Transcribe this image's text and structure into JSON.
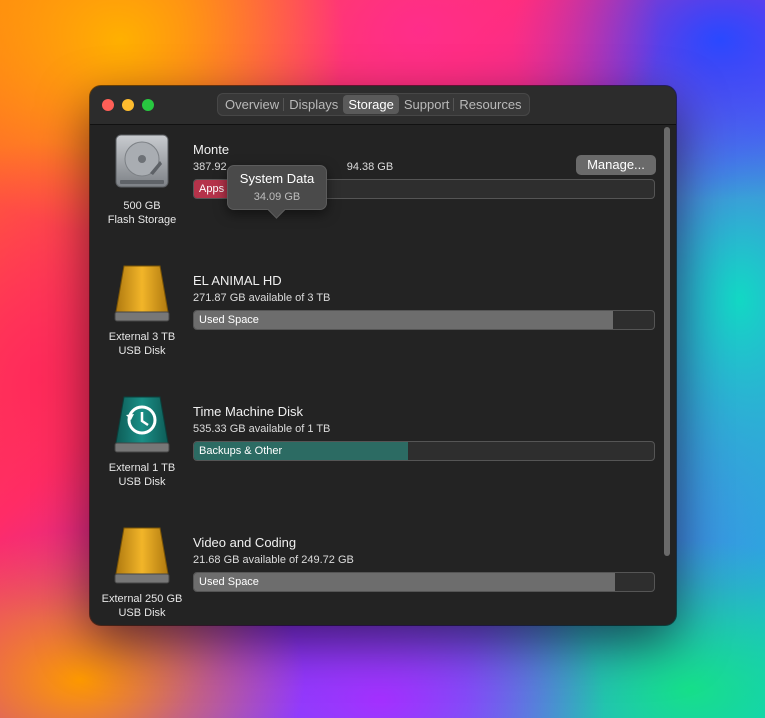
{
  "tabs": [
    "Overview",
    "Displays",
    "Storage",
    "Support",
    "Resources"
  ],
  "tooltip": {
    "title": "System Data",
    "value": "34.09 GB"
  },
  "manage_label": "Manage...",
  "disks": [
    {
      "name": "Monterey",
      "name_visible": "Monte",
      "available": "387.92 GB available of 494.38 GB",
      "available_visible_left": "387.92 ",
      "available_visible_right": "94.38 GB",
      "caption": [
        "500 GB",
        "Flash Storage"
      ],
      "bar_label": "Apps",
      "colors": {
        "apps": "#b5334a"
      }
    },
    {
      "name": "EL ANIMAL HD",
      "available": "271.87 GB available of 3 TB",
      "caption": [
        "External 3 TB",
        "USB Disk"
      ],
      "bar_label": "Used Space",
      "used_fraction": 0.909
    },
    {
      "name": "Time Machine Disk",
      "available": "535.33 GB available of 1 TB",
      "caption": [
        "External 1 TB",
        "USB Disk"
      ],
      "bar_label": "Backups & Other",
      "used_fraction": 0.465,
      "colors": {
        "backups": "#2c6b63"
      }
    },
    {
      "name": "Video and Coding",
      "available": "21.68 GB available of 249.72 GB",
      "caption": [
        "External 250 GB",
        "USB Disk"
      ],
      "bar_label": "Used Space",
      "used_fraction": 0.913
    }
  ]
}
